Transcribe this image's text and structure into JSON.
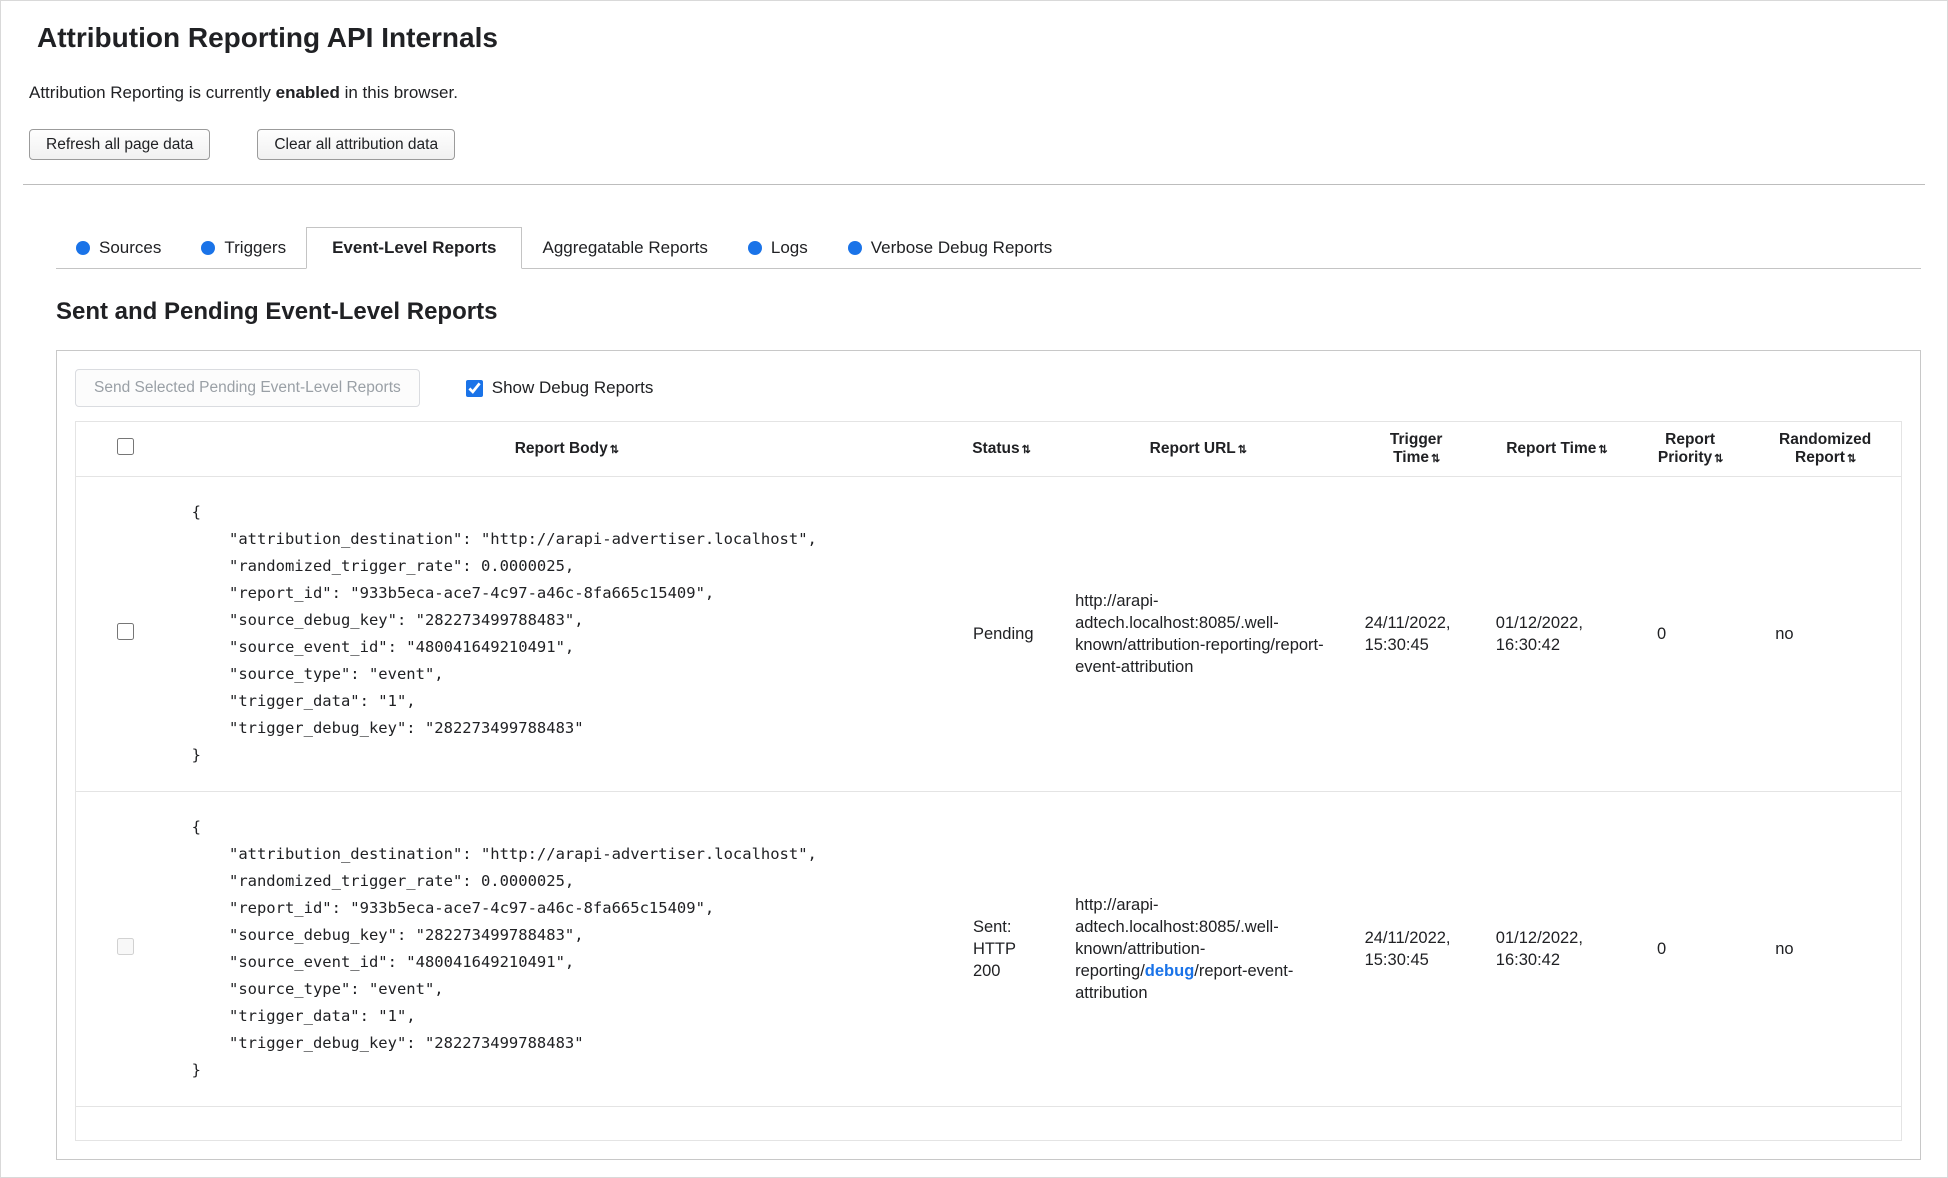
{
  "header": {
    "title": "Attribution Reporting API Internals",
    "status": {
      "prefix": "Attribution Reporting is currently ",
      "emphasis": "enabled",
      "suffix": " in this browser."
    },
    "buttons": {
      "refresh": "Refresh all page data",
      "clear": "Clear all attribution data"
    }
  },
  "tabs": [
    {
      "label": "Sources",
      "has_dot": true,
      "active": false
    },
    {
      "label": "Triggers",
      "has_dot": true,
      "active": false
    },
    {
      "label": "Event-Level Reports",
      "has_dot": false,
      "active": true
    },
    {
      "label": "Aggregatable Reports",
      "has_dot": false,
      "active": false
    },
    {
      "label": "Logs",
      "has_dot": true,
      "active": false
    },
    {
      "label": "Verbose Debug Reports",
      "has_dot": true,
      "active": false
    }
  ],
  "section": {
    "heading": "Sent and Pending Event-Level Reports",
    "send_button": "Send Selected Pending Event-Level Reports",
    "show_debug_label": "Show Debug Reports",
    "show_debug_checked": true
  },
  "table": {
    "sort_icon": "⇅",
    "select_all_checked": false,
    "columns": [
      "Report Body",
      "Status",
      "Report URL",
      "Trigger Time",
      "Report Time",
      "Report Priority",
      "Randomized Report"
    ],
    "rows": [
      {
        "checked": false,
        "checkbox_enabled": true,
        "body": "{\n    \"attribution_destination\": \"http://arapi-advertiser.localhost\",\n    \"randomized_trigger_rate\": 0.0000025,\n    \"report_id\": \"933b5eca-ace7-4c97-a46c-8fa665c15409\",\n    \"source_debug_key\": \"282273499788483\",\n    \"source_event_id\": \"480041649210491\",\n    \"source_type\": \"event\",\n    \"trigger_data\": \"1\",\n    \"trigger_debug_key\": \"282273499788483\"\n}",
        "status": "Pending",
        "url_prefix": "http://arapi-adtech.localhost:8085/.well-known/attribution-reporting/",
        "url_highlight": "",
        "url_suffix": "report-event-attribution",
        "trigger_time": "24/11/2022, 15:30:45",
        "report_time": "01/12/2022, 16:30:42",
        "report_priority": "0",
        "randomized_report": "no"
      },
      {
        "checked": false,
        "checkbox_enabled": false,
        "body": "{\n    \"attribution_destination\": \"http://arapi-advertiser.localhost\",\n    \"randomized_trigger_rate\": 0.0000025,\n    \"report_id\": \"933b5eca-ace7-4c97-a46c-8fa665c15409\",\n    \"source_debug_key\": \"282273499788483\",\n    \"source_event_id\": \"480041649210491\",\n    \"source_type\": \"event\",\n    \"trigger_data\": \"1\",\n    \"trigger_debug_key\": \"282273499788483\"\n}",
        "status": "Sent: HTTP 200",
        "url_prefix": "http://arapi-adtech.localhost:8085/.well-known/attribution-reporting/",
        "url_highlight": "debug",
        "url_suffix": "/report-event-attribution",
        "trigger_time": "24/11/2022, 15:30:45",
        "report_time": "01/12/2022, 16:30:42",
        "report_priority": "0",
        "randomized_report": "no"
      }
    ]
  },
  "colors": {
    "accent_blue": "#1a73e8",
    "debug_link_blue": "#1a73e8",
    "disabled_text": "#9aa0a6"
  }
}
